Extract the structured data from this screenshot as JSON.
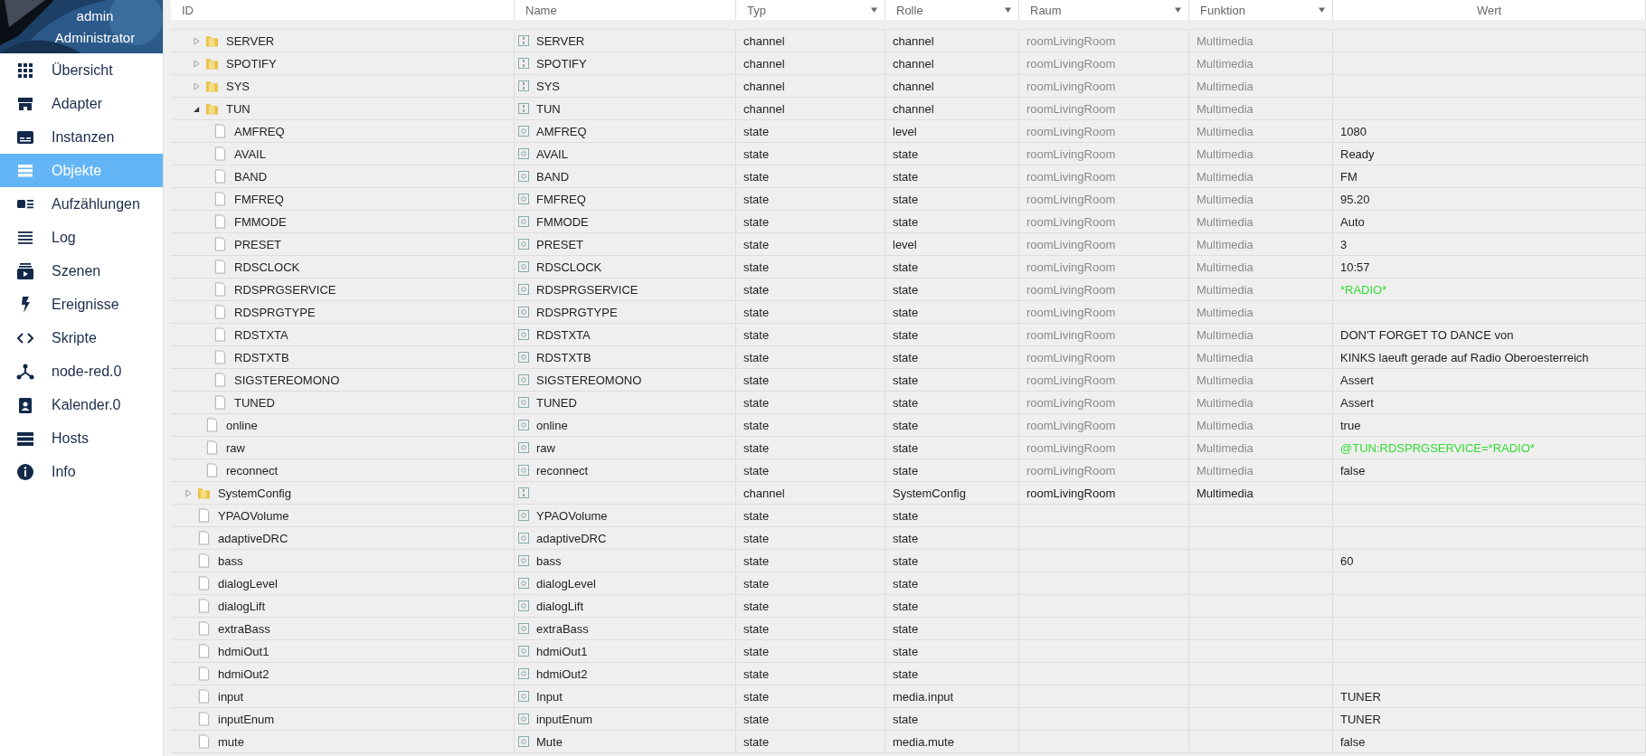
{
  "sidebar": {
    "user": "admin",
    "role": "Administrator",
    "items": [
      {
        "label": "Übersicht",
        "selected": false
      },
      {
        "label": "Adapter",
        "selected": false
      },
      {
        "label": "Instanzen",
        "selected": false
      },
      {
        "label": "Objekte",
        "selected": true
      },
      {
        "label": "Aufzählungen",
        "selected": false
      },
      {
        "label": "Log",
        "selected": false
      },
      {
        "label": "Szenen",
        "selected": false
      },
      {
        "label": "Ereignisse",
        "selected": false
      },
      {
        "label": "Skripte",
        "selected": false
      },
      {
        "label": "node-red.0",
        "selected": false
      },
      {
        "label": "Kalender.0",
        "selected": false
      },
      {
        "label": "Hosts",
        "selected": false
      },
      {
        "label": "Info",
        "selected": false
      }
    ]
  },
  "table": {
    "columns": [
      {
        "label": "ID",
        "filter": false
      },
      {
        "label": "Name",
        "filter": false
      },
      {
        "label": "Typ",
        "filter": true
      },
      {
        "label": "Rolle",
        "filter": true
      },
      {
        "label": "Raum",
        "filter": true
      },
      {
        "label": "Funktion",
        "filter": true
      },
      {
        "label": "Wert",
        "filter": false
      }
    ],
    "rows": [
      {
        "children": [
          {
            "kind": "folder",
            "expanded": false,
            "id": "SERVER",
            "name": "SERVER",
            "type": "channel",
            "role": "channel",
            "room": "roomLivingRoom",
            "function": "Multimedia",
            "inherited": true
          },
          {
            "kind": "folder",
            "expanded": false,
            "id": "SPOTIFY",
            "name": "SPOTIFY",
            "type": "channel",
            "role": "channel",
            "room": "roomLivingRoom",
            "function": "Multimedia",
            "inherited": true
          },
          {
            "kind": "folder",
            "expanded": false,
            "id": "SYS",
            "name": "SYS",
            "type": "channel",
            "role": "channel",
            "room": "roomLivingRoom",
            "function": "Multimedia",
            "inherited": true
          },
          {
            "kind": "folder",
            "expanded": true,
            "id": "TUN",
            "name": "TUN",
            "type": "channel",
            "role": "channel",
            "room": "roomLivingRoom",
            "function": "Multimedia",
            "inherited": true,
            "children": [
              {
                "kind": "state",
                "id": "AMFREQ",
                "name": "AMFREQ",
                "type": "state",
                "role": "level",
                "room": "roomLivingRoom",
                "function": "Multimedia",
                "inherited": true,
                "value": "1080"
              },
              {
                "kind": "state",
                "id": "AVAIL",
                "name": "AVAIL",
                "type": "state",
                "role": "state",
                "room": "roomLivingRoom",
                "function": "Multimedia",
                "inherited": true,
                "value": "Ready"
              },
              {
                "kind": "state",
                "id": "BAND",
                "name": "BAND",
                "type": "state",
                "role": "state",
                "room": "roomLivingRoom",
                "function": "Multimedia",
                "inherited": true,
                "value": "FM"
              },
              {
                "kind": "state",
                "id": "FMFREQ",
                "name": "FMFREQ",
                "type": "state",
                "role": "state",
                "room": "roomLivingRoom",
                "function": "Multimedia",
                "inherited": true,
                "value": "95.20"
              },
              {
                "kind": "state",
                "id": "FMMODE",
                "name": "FMMODE",
                "type": "state",
                "role": "state",
                "room": "roomLivingRoom",
                "function": "Multimedia",
                "inherited": true,
                "value": "Auto"
              },
              {
                "kind": "state",
                "id": "PRESET",
                "name": "PRESET",
                "type": "state",
                "role": "level",
                "room": "roomLivingRoom",
                "function": "Multimedia",
                "inherited": true,
                "value": "3"
              },
              {
                "kind": "state",
                "id": "RDSCLOCK",
                "name": "RDSCLOCK",
                "type": "state",
                "role": "state",
                "room": "roomLivingRoom",
                "function": "Multimedia",
                "inherited": true,
                "value": "10:57"
              },
              {
                "kind": "state",
                "id": "RDSPRGSERVICE",
                "name": "RDSPRGSERVICE",
                "type": "state",
                "role": "state",
                "room": "roomLivingRoom",
                "function": "Multimedia",
                "inherited": true,
                "value": "*RADIO*",
                "color": "#33dd33"
              },
              {
                "kind": "state",
                "id": "RDSPRGTYPE",
                "name": "RDSPRGTYPE",
                "type": "state",
                "role": "state",
                "room": "roomLivingRoom",
                "function": "Multimedia",
                "inherited": true
              },
              {
                "kind": "state",
                "id": "RDSTXTA",
                "name": "RDSTXTA",
                "type": "state",
                "role": "state",
                "room": "roomLivingRoom",
                "function": "Multimedia",
                "inherited": true,
                "value": "DON'T FORGET TO DANCE von"
              },
              {
                "kind": "state",
                "id": "RDSTXTB",
                "name": "RDSTXTB",
                "type": "state",
                "role": "state",
                "room": "roomLivingRoom",
                "function": "Multimedia",
                "inherited": true,
                "value": "KINKS laeuft gerade auf Radio Oberoesterreich"
              },
              {
                "kind": "state",
                "id": "SIGSTEREOMONO",
                "name": "SIGSTEREOMONO",
                "type": "state",
                "role": "state",
                "room": "roomLivingRoom",
                "function": "Multimedia",
                "inherited": true,
                "value": "Assert"
              },
              {
                "kind": "state",
                "id": "TUNED",
                "name": "TUNED",
                "type": "state",
                "role": "state",
                "room": "roomLivingRoom",
                "function": "Multimedia",
                "inherited": true,
                "value": "Assert"
              }
            ]
          },
          {
            "kind": "state",
            "id": "online",
            "name": "online",
            "type": "state",
            "role": "state",
            "room": "roomLivingRoom",
            "function": "Multimedia",
            "inherited": true,
            "value": "true"
          },
          {
            "kind": "state",
            "id": "raw",
            "name": "raw",
            "type": "state",
            "role": "state",
            "room": "roomLivingRoom",
            "function": "Multimedia",
            "inherited": true,
            "value": "@TUN:RDSPRGSERVICE=*RADIO*",
            "color": "#33dd33"
          },
          {
            "kind": "state",
            "id": "reconnect",
            "name": "reconnect",
            "type": "state",
            "role": "state",
            "room": "roomLivingRoom",
            "function": "Multimedia",
            "inherited": true,
            "value": "false"
          }
        ]
      },
      {
        "kind": "folder",
        "expanded": false,
        "id": "SystemConfig",
        "type": "channel",
        "role": "SystemConfig",
        "room": "roomLivingRoom",
        "function": "Multimedia",
        "inherited": false
      },
      {
        "kind": "state",
        "id": "YPAOVolume",
        "name": "YPAOVolume",
        "type": "state",
        "role": "state"
      },
      {
        "kind": "state",
        "id": "adaptiveDRC",
        "name": "adaptiveDRC",
        "type": "state",
        "role": "state"
      },
      {
        "kind": "state",
        "id": "bass",
        "name": "bass",
        "type": "state",
        "role": "state",
        "value": "60"
      },
      {
        "kind": "state",
        "id": "dialogLevel",
        "name": "dialogLevel",
        "type": "state",
        "role": "state"
      },
      {
        "kind": "state",
        "id": "dialogLift",
        "name": "dialogLift",
        "type": "state",
        "role": "state"
      },
      {
        "kind": "state",
        "id": "extraBass",
        "name": "extraBass",
        "type": "state",
        "role": "state"
      },
      {
        "kind": "state",
        "id": "hdmiOut1",
        "name": "hdmiOut1",
        "type": "state",
        "role": "state"
      },
      {
        "kind": "state",
        "id": "hdmiOut2",
        "name": "hdmiOut2",
        "type": "state",
        "role": "state"
      },
      {
        "kind": "state",
        "id": "input",
        "name": "Input",
        "type": "state",
        "role": "media.input",
        "value": "TUNER"
      },
      {
        "kind": "state",
        "id": "inputEnum",
        "name": "inputEnum",
        "type": "state",
        "role": "state",
        "value": "TUNER"
      },
      {
        "kind": "state",
        "id": "mute",
        "name": "Mute",
        "type": "state",
        "role": "media.mute",
        "value": "false"
      }
    ]
  }
}
